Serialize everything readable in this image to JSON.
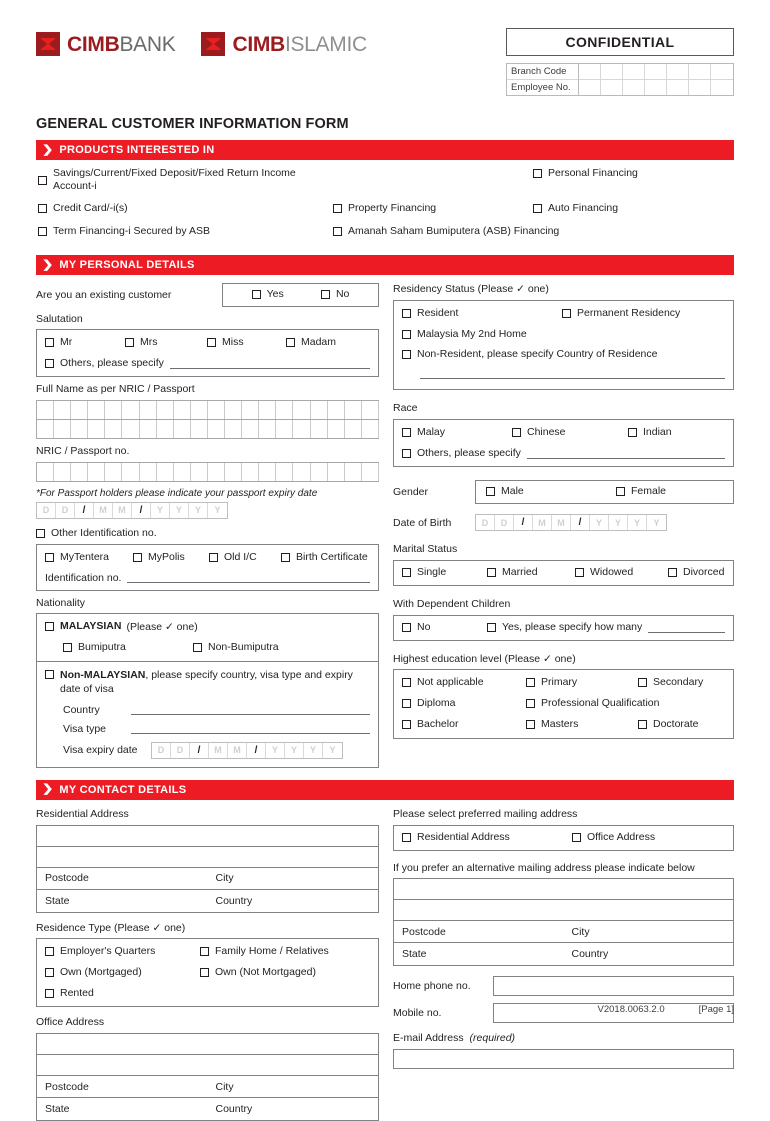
{
  "header": {
    "logo_bank": {
      "brand": "CIMB",
      "suffix": "BANK"
    },
    "logo_islamic": {
      "brand": "CIMB",
      "suffix": "ISLAMIC"
    },
    "confidential": "CONFIDENTIAL",
    "branch_code_label": "Branch Code",
    "employee_no_label": "Employee No.",
    "code_cells": 7,
    "form_title": "GENERAL CUSTOMER INFORMATION FORM"
  },
  "sections": {
    "products": "PRODUCTS INTERESTED IN",
    "personal": "MY PERSONAL DETAILS",
    "contact": "MY CONTACT DETAILS"
  },
  "products": {
    "row1": [
      "Savings/Current/Fixed Deposit/Fixed Return Income Account-i",
      "",
      "Personal Financing"
    ],
    "row2": [
      "Credit Card/-i(s)",
      "Property Financing",
      "Auto Financing"
    ],
    "row3": [
      "Term Financing-i Secured by ASB",
      "Amanah Saham Bumiputera (ASB) Financing",
      ""
    ]
  },
  "personal": {
    "existing_customer_label": "Are you an existing customer",
    "existing_customer_options": [
      "Yes",
      "No"
    ],
    "salutation_label": "Salutation",
    "salutation_options": [
      "Mr",
      "Mrs",
      "Miss",
      "Madam"
    ],
    "salutation_other": "Others, please specify",
    "full_name_label": "Full Name as per NRIC / Passport",
    "full_name_cells": 20,
    "nric_label": "NRIC / Passport no.",
    "nric_cells": 20,
    "passport_note": "*For Passport holders please indicate your passport expiry date",
    "other_id_label": "Other Identification no.",
    "other_id_options": [
      "MyTentera",
      "MyPolis",
      "Old I/C",
      "Birth Certificate"
    ],
    "identification_no_label": "Identification no.",
    "nationality_label": "Nationality",
    "malaysian_label": "MALAYSIAN",
    "malaysian_hint": "(Please ✓ one)",
    "malaysian_options": [
      "Bumiputra",
      "Non-Bumiputra"
    ],
    "non_malaysian_label": "Non-MALAYSIAN",
    "non_malaysian_rest": ", please specify country, visa type and expiry date of visa",
    "country_label": "Country",
    "visa_type_label": "Visa type",
    "visa_expiry_label": "Visa expiry date",
    "residency_label": "Residency Status (Please ✓ one)",
    "residency_options": [
      "Resident",
      "Permanent Residency",
      "Malaysia My 2nd Home",
      "Non-Resident, please specify Country of Residence"
    ],
    "race_label": "Race",
    "race_options": [
      "Malay",
      "Chinese",
      "Indian"
    ],
    "race_other": "Others, please specify",
    "gender_label": "Gender",
    "gender_options": [
      "Male",
      "Female"
    ],
    "dob_label": "Date of Birth",
    "marital_label": "Marital Status",
    "marital_options": [
      "Single",
      "Married",
      "Widowed",
      "Divorced"
    ],
    "dependents_label": "With Dependent Children",
    "dependents_no": "No",
    "dependents_yes": "Yes, please specify how many",
    "education_label": "Highest education level (Please ✓ one)",
    "education_options": [
      "Not applicable",
      "Primary",
      "Secondary",
      "Diploma",
      "Professional Qualification",
      "Bachelor",
      "Masters",
      "Doctorate"
    ]
  },
  "date_placeholder": [
    "D",
    "D",
    "/",
    "M",
    "M",
    "/",
    "Y",
    "Y",
    "Y",
    "Y"
  ],
  "contact": {
    "residential_address_label": "Residential Address",
    "office_address_label": "Office Address",
    "postcode_label": "Postcode",
    "city_label": "City",
    "state_label": "State",
    "country_label": "Country",
    "residence_type_label": "Residence Type (Please ✓ one)",
    "residence_type_options": [
      "Employer's Quarters",
      "Family Home / Relatives",
      "Own (Mortgaged)",
      "Own (Not Mortgaged)",
      "Rented"
    ],
    "preferred_mailing_label": "Please select preferred mailing address",
    "preferred_mailing_options": [
      "Residential Address",
      "Office Address"
    ],
    "alternative_label": "If you prefer an alternative mailing address please indicate below",
    "home_phone_label": "Home phone no.",
    "mobile_label": "Mobile no.",
    "email_label": "E-mail Address",
    "email_required": "(required)"
  },
  "footer": {
    "version": "V2018.0063.2.0",
    "page": "[Page 1]"
  },
  "colors": {
    "accent": "#ed1c24",
    "logo_dark": "#9b1b1e",
    "text": "#231f20"
  }
}
